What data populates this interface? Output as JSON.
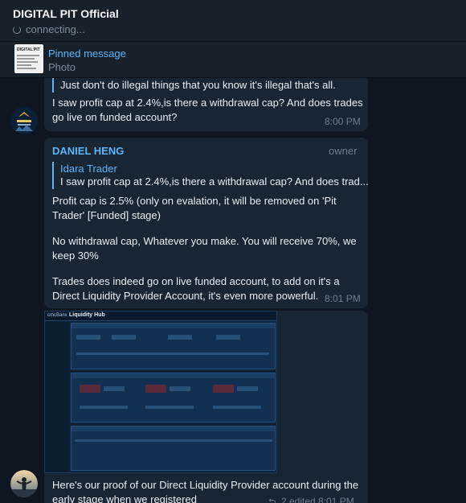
{
  "header": {
    "title": "DIGITAL PIT Official",
    "status": "connecting..."
  },
  "pinned": {
    "title": "Pinned message",
    "subtitle": "Photo",
    "thumb_text": "DIGITAL PIT"
  },
  "messages": [
    {
      "quote": "Just don't do illegal things that you know it's illegal that's all.",
      "text_lines": [
        "I saw profit cap at 2.4%,is there a withdrawal cap? And does trades",
        "go live on funded account?"
      ],
      "time": "8:00 PM",
      "avatar_label": "IDARA TRADER"
    },
    {
      "sender": "DANIEL HENG",
      "role": "owner",
      "reply_name": "Idara Trader",
      "reply_text": "I saw profit cap at 2.4%,is there a withdrawal cap? And does trad...",
      "p1": [
        "Profit cap is 2.5% (only on evalation, it will be removed on 'Pit",
        "Trader' [Funded] stage)"
      ],
      "p2": [
        "No withdrawal cap, Whatever you make. You will receive 70%, we",
        "keep 30%"
      ],
      "p3": [
        "Trades does indeed go on live funded account, to add on it's a",
        "Direct Liquidity Provider Account, it's even more powerful."
      ],
      "time": "8:01 PM"
    },
    {
      "image_title": "Liquidity Hub",
      "image_logo": "cmcBanx",
      "caption_lines": [
        "Here's our proof of our Direct Liquidity Provider account during the",
        "early stage when we registered"
      ],
      "meta": "2  edited 8:01 PM"
    }
  ]
}
